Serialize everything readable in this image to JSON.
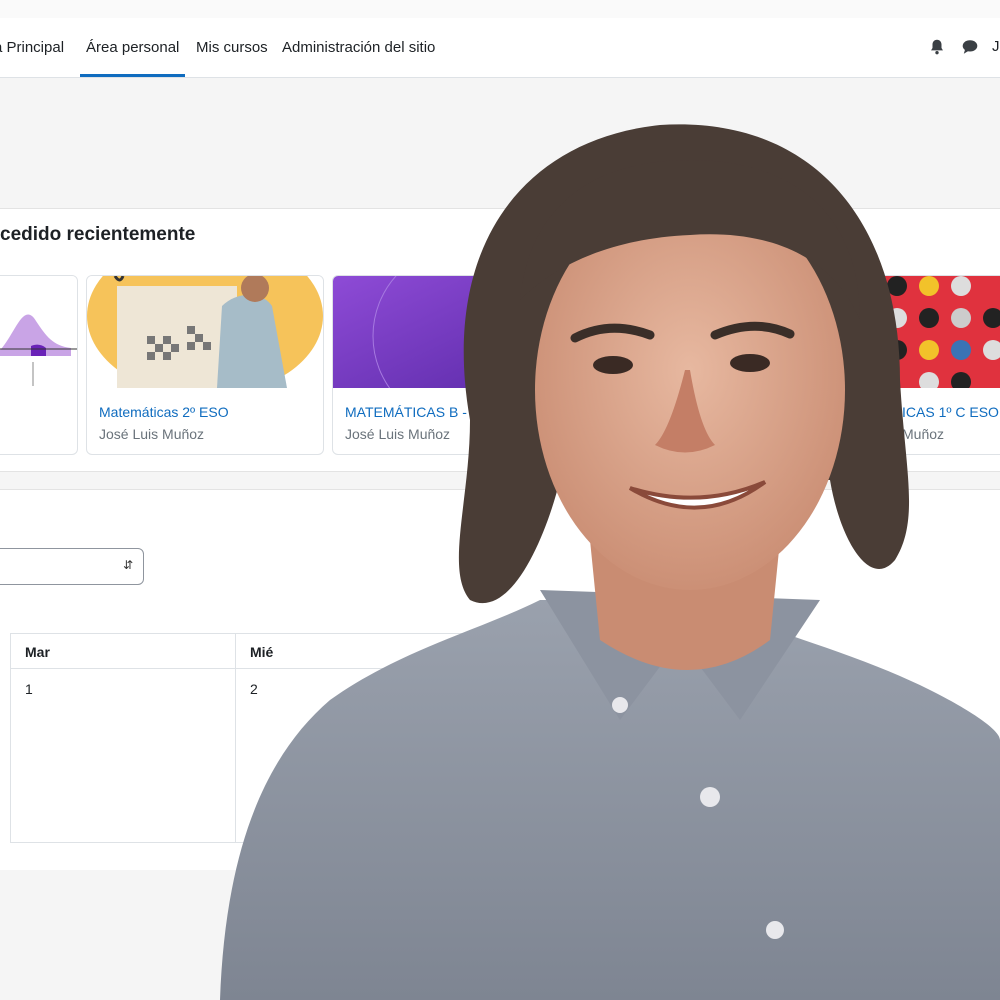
{
  "nav": {
    "items": [
      {
        "label": "a Principal",
        "active": false
      },
      {
        "label": "Área personal",
        "active": true
      },
      {
        "label": "Mis cursos",
        "active": false
      },
      {
        "label": "Administración del sitio",
        "active": false
      }
    ],
    "icons": [
      "bell-icon",
      "chat-icon"
    ],
    "user_initial": "J"
  },
  "recent": {
    "title": "cedido recientemente",
    "courses": [
      {
        "name": "",
        "teacher": "",
        "image": "bell-curve-chart"
      },
      {
        "name": "Matemáticas 2º ESO",
        "teacher": "José Luis Muñoz",
        "image": "greek-scholar-illustration"
      },
      {
        "name": "MATEMÁTICAS B - 4",
        "teacher": "José Luis Muñoz",
        "image": "purple-gradient"
      },
      {
        "name": "ICAS 1º C ESO",
        "teacher": "Muñoz",
        "image": "red-dot-pattern"
      }
    ]
  },
  "calendar": {
    "select_value": "",
    "days": [
      {
        "head": "Mar",
        "num": "1"
      },
      {
        "head": "Mié",
        "num": "2"
      }
    ]
  },
  "colors": {
    "accent": "#0f6cbf",
    "muted": "#6a737b"
  }
}
